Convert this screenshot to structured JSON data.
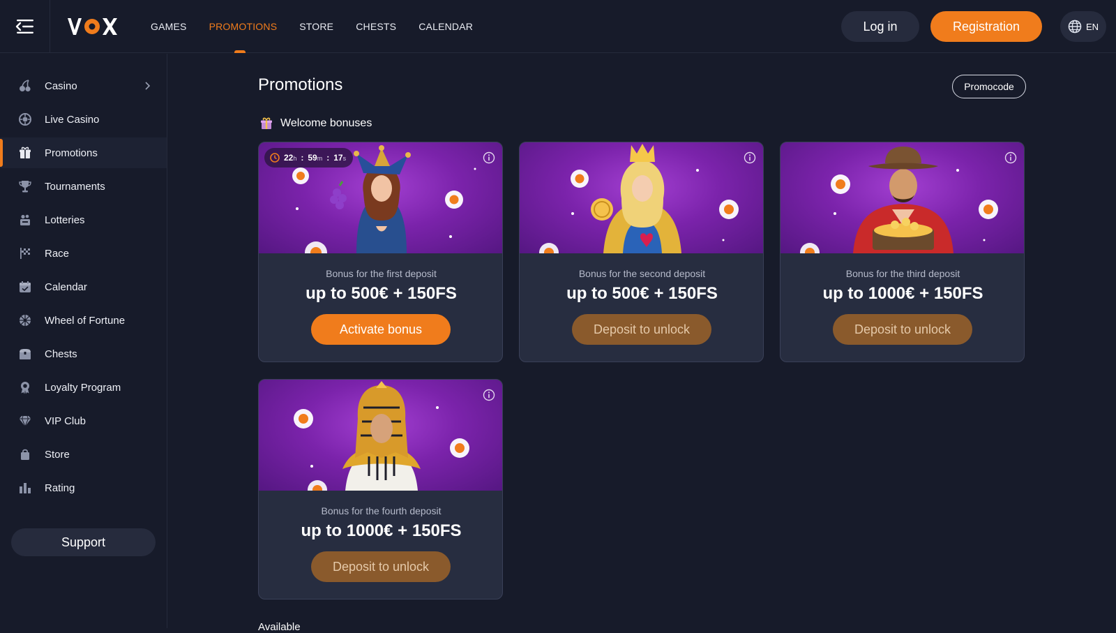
{
  "header": {
    "logo_text": "VOX",
    "nav": [
      {
        "label": "GAMES",
        "active": false
      },
      {
        "label": "PROMOTIONS",
        "active": true
      },
      {
        "label": "STORE",
        "active": false
      },
      {
        "label": "CHESTS",
        "active": false
      },
      {
        "label": "CALENDAR",
        "active": false
      }
    ],
    "login_label": "Log in",
    "register_label": "Registration",
    "language": "EN"
  },
  "sidebar": {
    "items": [
      {
        "label": "Casino",
        "icon": "cherries-icon",
        "has_chevron": true
      },
      {
        "label": "Live Casino",
        "icon": "roulette-icon"
      },
      {
        "label": "Promotions",
        "icon": "gift-icon",
        "active": true
      },
      {
        "label": "Tournaments",
        "icon": "trophy-icon"
      },
      {
        "label": "Lotteries",
        "icon": "lottery-icon"
      },
      {
        "label": "Race",
        "icon": "race-flag-icon"
      },
      {
        "label": "Calendar",
        "icon": "calendar-icon"
      },
      {
        "label": "Wheel of Fortune",
        "icon": "wheel-icon"
      },
      {
        "label": "Chests",
        "icon": "chest-icon"
      },
      {
        "label": "Loyalty Program",
        "icon": "medal-icon"
      },
      {
        "label": "VIP Club",
        "icon": "diamond-icon"
      },
      {
        "label": "Store",
        "icon": "shopping-bag-icon"
      },
      {
        "label": "Rating",
        "icon": "rating-bars-icon"
      }
    ],
    "support_label": "Support"
  },
  "main": {
    "title": "Promotions",
    "promocode_label": "Promocode",
    "section_title": "Welcome bonuses",
    "cards": [
      {
        "subtitle": "Bonus for the first deposit",
        "amount": "up to 500€ + 150FS",
        "button": "Activate bonus",
        "state": "active",
        "character": "jester-queen",
        "timer": {
          "h": "22",
          "m": "59",
          "s": "17",
          "h_unit": "h",
          "m_unit": "m",
          "s_unit": "s"
        }
      },
      {
        "subtitle": "Bonus for the second deposit",
        "amount": "up to 500€ + 150FS",
        "button": "Deposit to unlock",
        "state": "locked",
        "character": "golden-queen"
      },
      {
        "subtitle": "Bonus for the third deposit",
        "amount": "up to 1000€ + 150FS",
        "button": "Deposit to unlock",
        "state": "locked",
        "character": "cowboy"
      },
      {
        "subtitle": "Bonus for the fourth deposit",
        "amount": "up to 1000€ + 150FS",
        "button": "Deposit to unlock",
        "state": "locked",
        "character": "pharaoh-queen"
      }
    ],
    "next_section_title": "Available"
  },
  "colors": {
    "background": "#171b2a",
    "accent": "#f07c1c",
    "card": "#272d40",
    "locked_button": "#8a5a2c",
    "promo_image": "#7b23ab"
  }
}
